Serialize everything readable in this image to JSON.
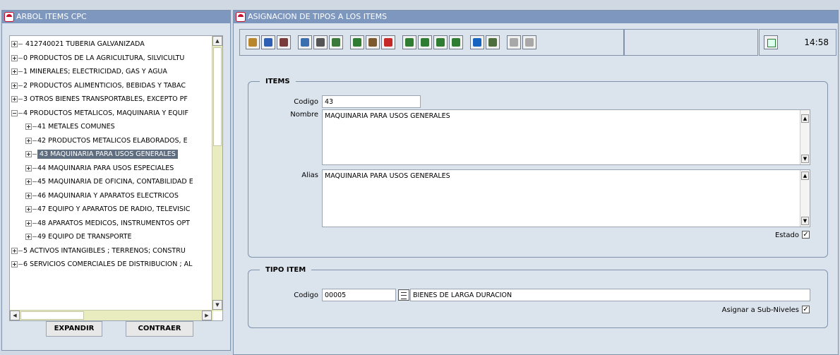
{
  "left_window": {
    "title": "ARBOL ITEMS CPC",
    "tree": [
      {
        "label": "412740021 TUBERIA GALVANIZADA",
        "level": 0,
        "expanded": false,
        "dash": true
      },
      {
        "label": "0 PRODUCTOS DE LA AGRICULTURA,  SILVICULTU",
        "level": 0,
        "expanded": false
      },
      {
        "label": "1 MINERALES; ELECTRICIDAD, GAS Y AGUA",
        "level": 0,
        "expanded": false
      },
      {
        "label": "2 PRODUCTOS ALIMENTICIOS, BEBIDAS Y TABAC",
        "level": 0,
        "expanded": false
      },
      {
        "label": "3 OTROS BIENES TRANSPORTABLES, EXCEPTO PF",
        "level": 0,
        "expanded": false
      },
      {
        "label": "4 PRODUCTOS METALICOS, MAQUINARIA Y EQUIF",
        "level": 0,
        "expanded": true
      },
      {
        "label": "41 METALES COMUNES",
        "level": 1,
        "expanded": false
      },
      {
        "label": "42 PRODUCTOS METALICOS ELABORADOS, E",
        "level": 1,
        "expanded": false
      },
      {
        "label": "43 MAQUINARIA PARA USOS GENERALES",
        "level": 1,
        "expanded": false,
        "selected": true
      },
      {
        "label": "44 MAQUINARIA PARA USOS ESPECIALES",
        "level": 1,
        "expanded": false
      },
      {
        "label": "45 MAQUINARIA DE OFICINA, CONTABILIDAD E",
        "level": 1,
        "expanded": false
      },
      {
        "label": "46 MAQUINARIA Y APARATOS ELECTRICOS",
        "level": 1,
        "expanded": false
      },
      {
        "label": "47 EQUIPO Y APARATOS DE RADIO, TELEVISIC",
        "level": 1,
        "expanded": false
      },
      {
        "label": "48 APARATOS MEDICOS, INSTRUMENTOS OPT",
        "level": 1,
        "expanded": false
      },
      {
        "label": "49 EQUIPO DE TRANSPORTE",
        "level": 1,
        "expanded": false
      },
      {
        "label": "5 ACTIVOS INTANGIBLES ;  TERRENOS; CONSTRU",
        "level": 0,
        "expanded": false
      },
      {
        "label": "6 SERVICIOS COMERCIALES DE DISTRIBUCION ; AL",
        "level": 0,
        "expanded": false
      }
    ],
    "expand_button": "EXPANDIR",
    "collapse_button": "CONTRAER"
  },
  "right_window": {
    "title": "ASIGNACION DE TIPOS A LOS ITEMS",
    "time": "14:58",
    "toolbar_icons": [
      {
        "name": "clear-icon",
        "color": "#b8862b"
      },
      {
        "name": "save-icon",
        "color": "#2d5fb3"
      },
      {
        "name": "print-icon",
        "color": "#7a3b3b"
      },
      {
        "name": "query-icon",
        "color": "#3b6fb0"
      },
      {
        "name": "list-icon",
        "color": "#555555"
      },
      {
        "name": "edit-icon",
        "color": "#3a7a3a"
      },
      {
        "name": "insert-record-icon",
        "color": "#2e7d32"
      },
      {
        "name": "duplicate-record-icon",
        "color": "#7d5a2e"
      },
      {
        "name": "delete-record-icon",
        "color": "#c62828"
      },
      {
        "name": "first-record-icon",
        "color": "#2e7d32"
      },
      {
        "name": "previous-record-icon",
        "color": "#2e7d32"
      },
      {
        "name": "next-record-icon",
        "color": "#2e7d32"
      },
      {
        "name": "last-record-icon",
        "color": "#2e7d32"
      },
      {
        "name": "help-icon",
        "color": "#1565c0"
      },
      {
        "name": "exit-icon",
        "color": "#4e6e3e"
      },
      {
        "name": "anchor-icon",
        "color": "#a8a8a8"
      },
      {
        "name": "check-icon",
        "color": "#a8a8a8"
      }
    ],
    "items": {
      "legend": "ITEMS",
      "codigo_label": "Codigo",
      "codigo_value": "43",
      "nombre_label": "Nombre",
      "nombre_value": "MAQUINARIA PARA USOS GENERALES",
      "alias_label": "Alias",
      "alias_value": "MAQUINARIA PARA USOS GENERALES",
      "estado_label": "Estado",
      "estado_checked": true
    },
    "tipo_item": {
      "legend": "TIPO ITEM",
      "codigo_label": "Codigo",
      "codigo_value": "00005",
      "descripcion_value": "BIENES DE LARGA DURACION",
      "subniveles_label": "Asignar a Sub-Niveles",
      "subniveles_checked": true
    }
  }
}
